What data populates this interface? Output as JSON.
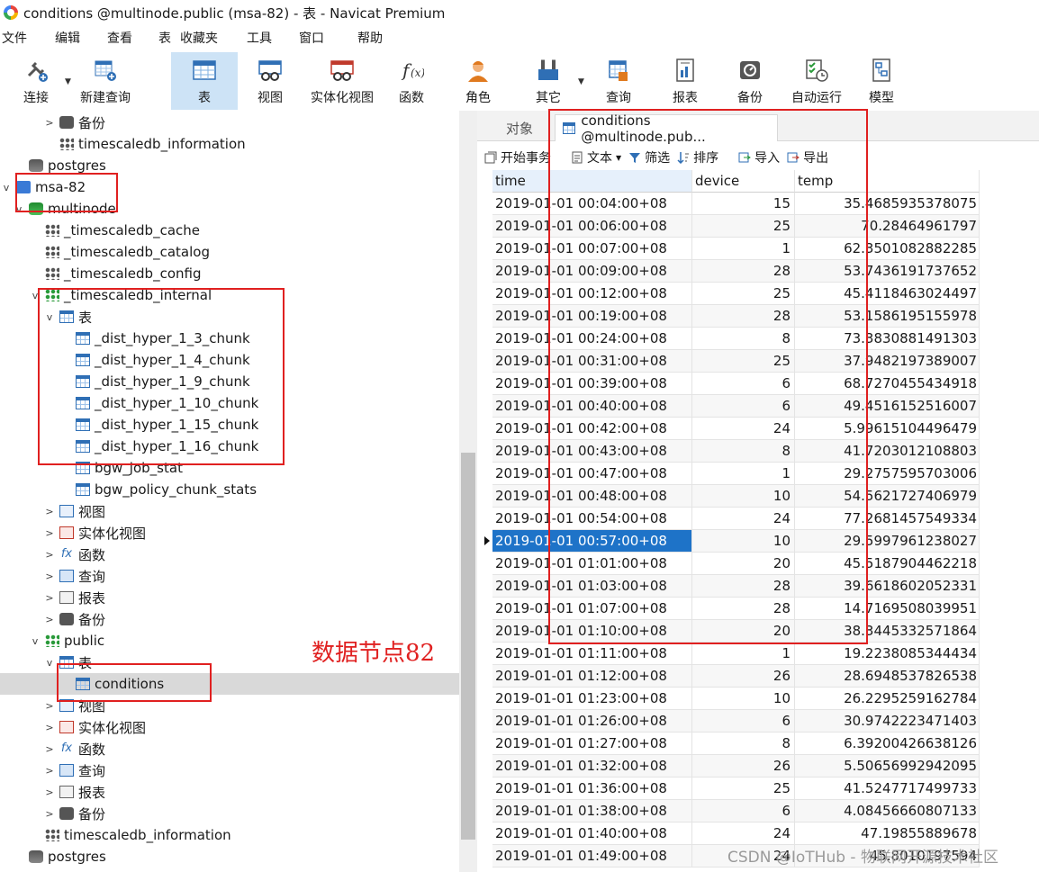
{
  "window": {
    "title": "conditions @multinode.public (msa-82) - 表 - Navicat Premium"
  },
  "menu": [
    "文件",
    "编辑",
    "查看",
    "表",
    "收藏夹",
    "工具",
    "窗口",
    "帮助"
  ],
  "toolbar": {
    "connect": "连接",
    "new_query": "新建查询",
    "table": "表",
    "view": "视图",
    "mview": "实体化视图",
    "func": "函数",
    "role": "角色",
    "other": "其它",
    "query": "查询",
    "report": "报表",
    "backup": "备份",
    "auto_run": "自动运行",
    "model": "模型"
  },
  "tree": {
    "backup_top": "备份",
    "tsdb_info_top": "timescaledb_information",
    "postgres_top": "postgres",
    "conn": "msa-82",
    "db": "multinode",
    "cache": "_timescaledb_cache",
    "catalog": "_timescaledb_catalog",
    "config": "_timescaledb_config",
    "internal": "_timescaledb_internal",
    "tables_label": "表",
    "chunks": [
      "_dist_hyper_1_3_chunk",
      "_dist_hyper_1_4_chunk",
      "_dist_hyper_1_9_chunk",
      "_dist_hyper_1_10_chunk",
      "_dist_hyper_1_15_chunk",
      "_dist_hyper_1_16_chunk",
      "bgw_job_stat",
      "bgw_policy_chunk_stats"
    ],
    "view": "视图",
    "mview": "实体化视图",
    "func": "函数",
    "query": "查询",
    "report": "报表",
    "backup": "备份",
    "public": "public",
    "tables_label2": "表",
    "conditions": "conditions",
    "view2": "视图",
    "mview2": "实体化视图",
    "func2": "函数",
    "query2": "查询",
    "report2": "报表",
    "backup2": "备份",
    "tsdb_info": "timescaledb_information",
    "postgres": "postgres"
  },
  "annotation": "数据节点82",
  "tabs": {
    "objects": "对象",
    "active": "conditions @multinode.pub..."
  },
  "subtoolbar": {
    "begin_tx": "开始事务",
    "text": "文本",
    "filter": "筛选",
    "sort": "排序",
    "import": "导入",
    "export": "导出"
  },
  "grid": {
    "columns": [
      "time",
      "device",
      "temp"
    ],
    "rows": [
      [
        "2019-01-01 00:04:00+08",
        "15",
        "35.4685935378075"
      ],
      [
        "2019-01-01 00:06:00+08",
        "25",
        "70.28464961797"
      ],
      [
        "2019-01-01 00:07:00+08",
        "1",
        "62.3501082882285"
      ],
      [
        "2019-01-01 00:09:00+08",
        "28",
        "53.7436191737652"
      ],
      [
        "2019-01-01 00:12:00+08",
        "25",
        "45.4118463024497"
      ],
      [
        "2019-01-01 00:19:00+08",
        "28",
        "53.1586195155978"
      ],
      [
        "2019-01-01 00:24:00+08",
        "8",
        "73.3830881491303"
      ],
      [
        "2019-01-01 00:31:00+08",
        "25",
        "37.9482197389007"
      ],
      [
        "2019-01-01 00:39:00+08",
        "6",
        "68.7270455434918"
      ],
      [
        "2019-01-01 00:40:00+08",
        "6",
        "49.4516152516007"
      ],
      [
        "2019-01-01 00:42:00+08",
        "24",
        "5.99615104496479"
      ],
      [
        "2019-01-01 00:43:00+08",
        "8",
        "41.7203012108803"
      ],
      [
        "2019-01-01 00:47:00+08",
        "1",
        "29.2757595703006"
      ],
      [
        "2019-01-01 00:48:00+08",
        "10",
        "54.5621727406979"
      ],
      [
        "2019-01-01 00:54:00+08",
        "24",
        "77.2681457549334"
      ],
      [
        "2019-01-01 00:57:00+08",
        "10",
        "29.5997961238027"
      ],
      [
        "2019-01-01 01:01:00+08",
        "20",
        "45.5187904462218"
      ],
      [
        "2019-01-01 01:03:00+08",
        "28",
        "39.6618602052331"
      ],
      [
        "2019-01-01 01:07:00+08",
        "28",
        "14.7169508039951"
      ],
      [
        "2019-01-01 01:10:00+08",
        "20",
        "38.3445332571864"
      ],
      [
        "2019-01-01 01:11:00+08",
        "1",
        "19.2238085344434"
      ],
      [
        "2019-01-01 01:12:00+08",
        "26",
        "28.6948537826538"
      ],
      [
        "2019-01-01 01:23:00+08",
        "10",
        "26.2295259162784"
      ],
      [
        "2019-01-01 01:26:00+08",
        "6",
        "30.9742223471403"
      ],
      [
        "2019-01-01 01:27:00+08",
        "8",
        "6.39200426638126"
      ],
      [
        "2019-01-01 01:32:00+08",
        "26",
        "5.50656992942095"
      ],
      [
        "2019-01-01 01:36:00+08",
        "25",
        "41.5247717499733"
      ],
      [
        "2019-01-01 01:38:00+08",
        "6",
        "4.08456660807133"
      ],
      [
        "2019-01-01 01:40:00+08",
        "24",
        "47.19855889678"
      ],
      [
        "2019-01-01 01:49:00+08",
        "24",
        "45.8010197594"
      ]
    ],
    "selected_row": 15
  },
  "watermark": "CSDN @IoTHub - 物联网开源技术社区",
  "colors": {
    "accent": "#1e73c8",
    "annotation": "#e02020",
    "active_tool": "#cde3f6"
  }
}
